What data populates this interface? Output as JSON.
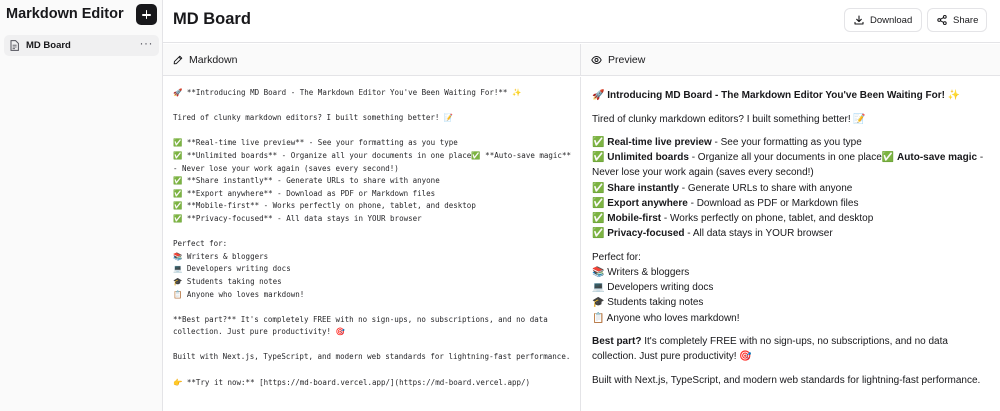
{
  "sidebar": {
    "app_title": "Markdown Editor",
    "new_icon": "plus-icon",
    "boards": [
      {
        "label": "MD Board",
        "icon": "document-icon",
        "more": "···"
      }
    ]
  },
  "header": {
    "title": "MD Board",
    "download_label": "Download",
    "share_label": "Share"
  },
  "panes": {
    "markdown_label": "Markdown",
    "preview_label": "Preview"
  },
  "editor": {
    "content": "🚀 **Introducing MD Board - The Markdown Editor You've Been Waiting For!** ✨\n\nTired of clunky markdown editors? I built something better! 📝\n\n✅ **Real-time live preview** - See your formatting as you type\n✅ **Unlimited boards** - Organize all your documents in one place✅ **Auto-save magic** - Never lose your work again (saves every second!)\n✅ **Share instantly** - Generate URLs to share with anyone\n✅ **Export anywhere** - Download as PDF or Markdown files\n✅ **Mobile-first** - Works perfectly on phone, tablet, and desktop\n✅ **Privacy-focused** - All data stays in YOUR browser\n\nPerfect for:\n📚 Writers & bloggers\n💻 Developers writing docs\n🎓 Students taking notes\n📋 Anyone who loves markdown!\n\n**Best part?** It's completely FREE with no sign-ups, no subscriptions, and no data collection. Just pure productivity! 🎯\n\nBuilt with Next.js, TypeScript, and modern web standards for lightning-fast performance.\n\n👉 **Try it now:** [https://md-board.vercel.app/](https://md-board.vercel.app/)"
  },
  "preview": {
    "title_emoji": "🚀",
    "title": "Introducing MD Board - The Markdown Editor You've Been Waiting For!",
    "title_emoji_end": "✨",
    "intro": "Tired of clunky markdown editors? I built something better! 📝",
    "check": "✅",
    "features": [
      {
        "bold": "Real-time live preview",
        "text": " - See your formatting as you type"
      },
      {
        "bold": "Unlimited boards",
        "text": " - Organize all your documents in one place"
      },
      {
        "bold": "Auto-save magic",
        "text": " - Never lose your work again (saves every second!)"
      },
      {
        "bold": "Share instantly",
        "text": " - Generate URLs to share with anyone"
      },
      {
        "bold": "Export anywhere",
        "text": " - Download as PDF or Markdown files"
      },
      {
        "bold": "Mobile-first",
        "text": " - Works perfectly on phone, tablet, and desktop"
      },
      {
        "bold": "Privacy-focused",
        "text": " - All data stays in YOUR browser"
      }
    ],
    "perfect_for": "Perfect for:",
    "audience": [
      "📚 Writers & bloggers",
      "💻 Developers writing docs",
      "🎓 Students taking notes",
      "📋 Anyone who loves markdown!"
    ],
    "best_bold": "Best part?",
    "best_text": " It's completely FREE with no sign-ups, no subscriptions, and no data collection. Just pure productivity! 🎯",
    "built": "Built with Next.js, TypeScript, and modern web standards for lightning-fast performance."
  },
  "colors": {
    "sidebar_bg": "#fafafa",
    "active_item_bg": "#f0f0f1",
    "border": "#e4e4e7",
    "text": "#18181b"
  }
}
